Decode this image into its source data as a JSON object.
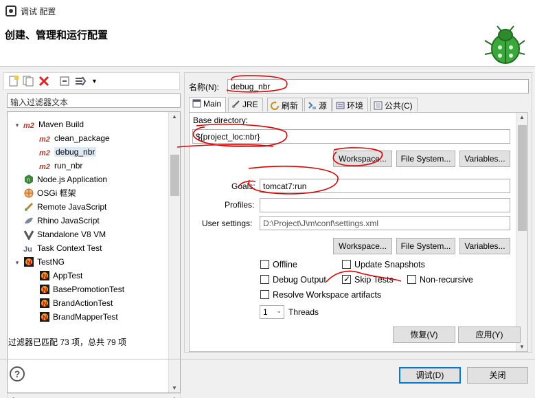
{
  "window": {
    "title": "调试 配置"
  },
  "header": {
    "heading": "创建、管理和运行配置"
  },
  "left": {
    "filter_placeholder": "输入过滤器文本",
    "tree": [
      {
        "label": "Maven Build",
        "icon": "m2-icon",
        "level": 0,
        "expanded": true
      },
      {
        "label": "clean_package",
        "icon": "m2-icon",
        "level": 1
      },
      {
        "label": "debug_nbr",
        "icon": "m2-icon",
        "level": 1,
        "selected": true
      },
      {
        "label": "run_nbr",
        "icon": "m2-icon",
        "level": 1
      },
      {
        "label": "Node.js Application",
        "icon": "nodejs-icon",
        "level": 0
      },
      {
        "label": "OSGi 框架",
        "icon": "osgi-icon",
        "level": 0
      },
      {
        "label": "Remote JavaScript",
        "icon": "remote-js-icon",
        "level": 0
      },
      {
        "label": "Rhino JavaScript",
        "icon": "rhino-icon",
        "level": 0
      },
      {
        "label": "Standalone V8 VM",
        "icon": "v8-icon",
        "level": 0
      },
      {
        "label": "Task Context Test",
        "icon": "ju-icon",
        "level": 0
      },
      {
        "label": "TestNG",
        "icon": "testng-icon",
        "level": 0,
        "expanded": true
      },
      {
        "label": "AppTest",
        "icon": "testng-icon",
        "level": 1
      },
      {
        "label": "BasePromotionTest",
        "icon": "testng-icon",
        "level": 1
      },
      {
        "label": "BrandActionTest",
        "icon": "testng-icon",
        "level": 1
      },
      {
        "label": "BrandMapperTest",
        "icon": "testng-icon",
        "level": 1
      }
    ],
    "status": "过滤器已匹配 73 项，总共 79 项"
  },
  "config": {
    "name_label": "名称(N):",
    "name_value": "debug_nbr",
    "tabs": [
      "Main",
      "JRE",
      "刷新",
      "源",
      "环境",
      "公共(C)"
    ],
    "base_dir_label": "Base directory:",
    "base_dir_value": "${project_loc:nbr}",
    "workspace_btn": "Workspace...",
    "filesystem_btn": "File System...",
    "variables_btn": "Variables...",
    "goals_label": "Goals:",
    "goals_value": "tomcat7:run",
    "profiles_label": "Profiles:",
    "profiles_value": "",
    "user_settings_label": "User settings:",
    "user_settings_value": "D:\\Project\\J\\m\\conf\\settings.xml",
    "checks": {
      "offline": "Offline",
      "update_snapshots": "Update Snapshots",
      "debug_output": "Debug Output",
      "skip_tests": "Skip Tests",
      "non_recursive": "Non-recursive",
      "resolve_workspace": "Resolve Workspace artifacts"
    },
    "threads_value": "1",
    "threads_label": "Threads",
    "revert_btn": "恢复(V)",
    "apply_btn": "应用(Y)"
  },
  "footer": {
    "debug_btn": "调试(D)",
    "close_btn": "关闭"
  },
  "colors": {
    "accent": "#0078d7",
    "annotation": "#e00000"
  }
}
